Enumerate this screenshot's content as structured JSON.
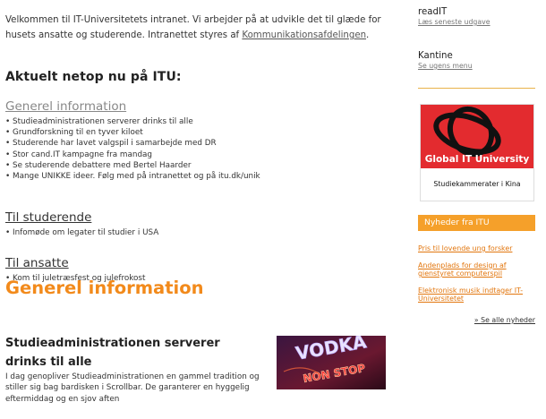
{
  "intro": {
    "text": "Velkommen til IT-Universitetets intranet. Vi arbejder på at udvikle det til glæde for husets ansatte og studerende. Intranettet styres af ",
    "link": "Kommunikationsafdelingen",
    "end": "."
  },
  "headline": "Aktuelt netop nu på ITU:",
  "sections": [
    {
      "title": "Generel information",
      "items": [
        "Studieadministrationen serverer drinks til alle",
        "Grundforskning til en tyver kiloet",
        "Studerende har lavet valgspil i samarbejde med DR",
        "Stor cand.IT kampagne fra mandag",
        "Se studerende debattere med Bertel Haarder",
        "Mange UNIKKE ideer. Følg med på intranettet og på itu.dk/unik"
      ]
    },
    {
      "title": "Til studerende",
      "items": [
        "Infomøde om legater til studier i USA"
      ]
    },
    {
      "title": "Til ansatte",
      "items": [
        "Kom til juletræsfest og julefrokost"
      ]
    }
  ],
  "big_title": "Generel information",
  "article": {
    "title": "Studieadministrationen serverer drinks til alle",
    "body": "I dag genopliver Studieadministrationen en gammel tradition og stiller sig bag bardisken i Scrollbar. De garanterer en hyggelig eftermiddag og en sjov aften",
    "image_text": [
      "VODKA",
      "NON STOP"
    ]
  },
  "sidebar": {
    "readit": {
      "title": "readIT",
      "link": "Læs seneste udgave"
    },
    "kantine": {
      "title": "Kantine",
      "link": "Se ugens menu"
    },
    "banner": {
      "logo_text": "Global IT University",
      "caption": "Studiekammerater i Kina"
    },
    "news_header": "Nyheder fra ITU",
    "news": [
      "Pris til lovende ung forsker",
      "Andenplads for design af gienstyret computerspil",
      "Elektronisk musik indtager IT-Universitetet"
    ],
    "news_more": "» Se alle nyheder"
  },
  "colors": {
    "accent": "#f28a1b",
    "news_bar": "#f5a02a",
    "banner_red": "#e32b2f"
  }
}
